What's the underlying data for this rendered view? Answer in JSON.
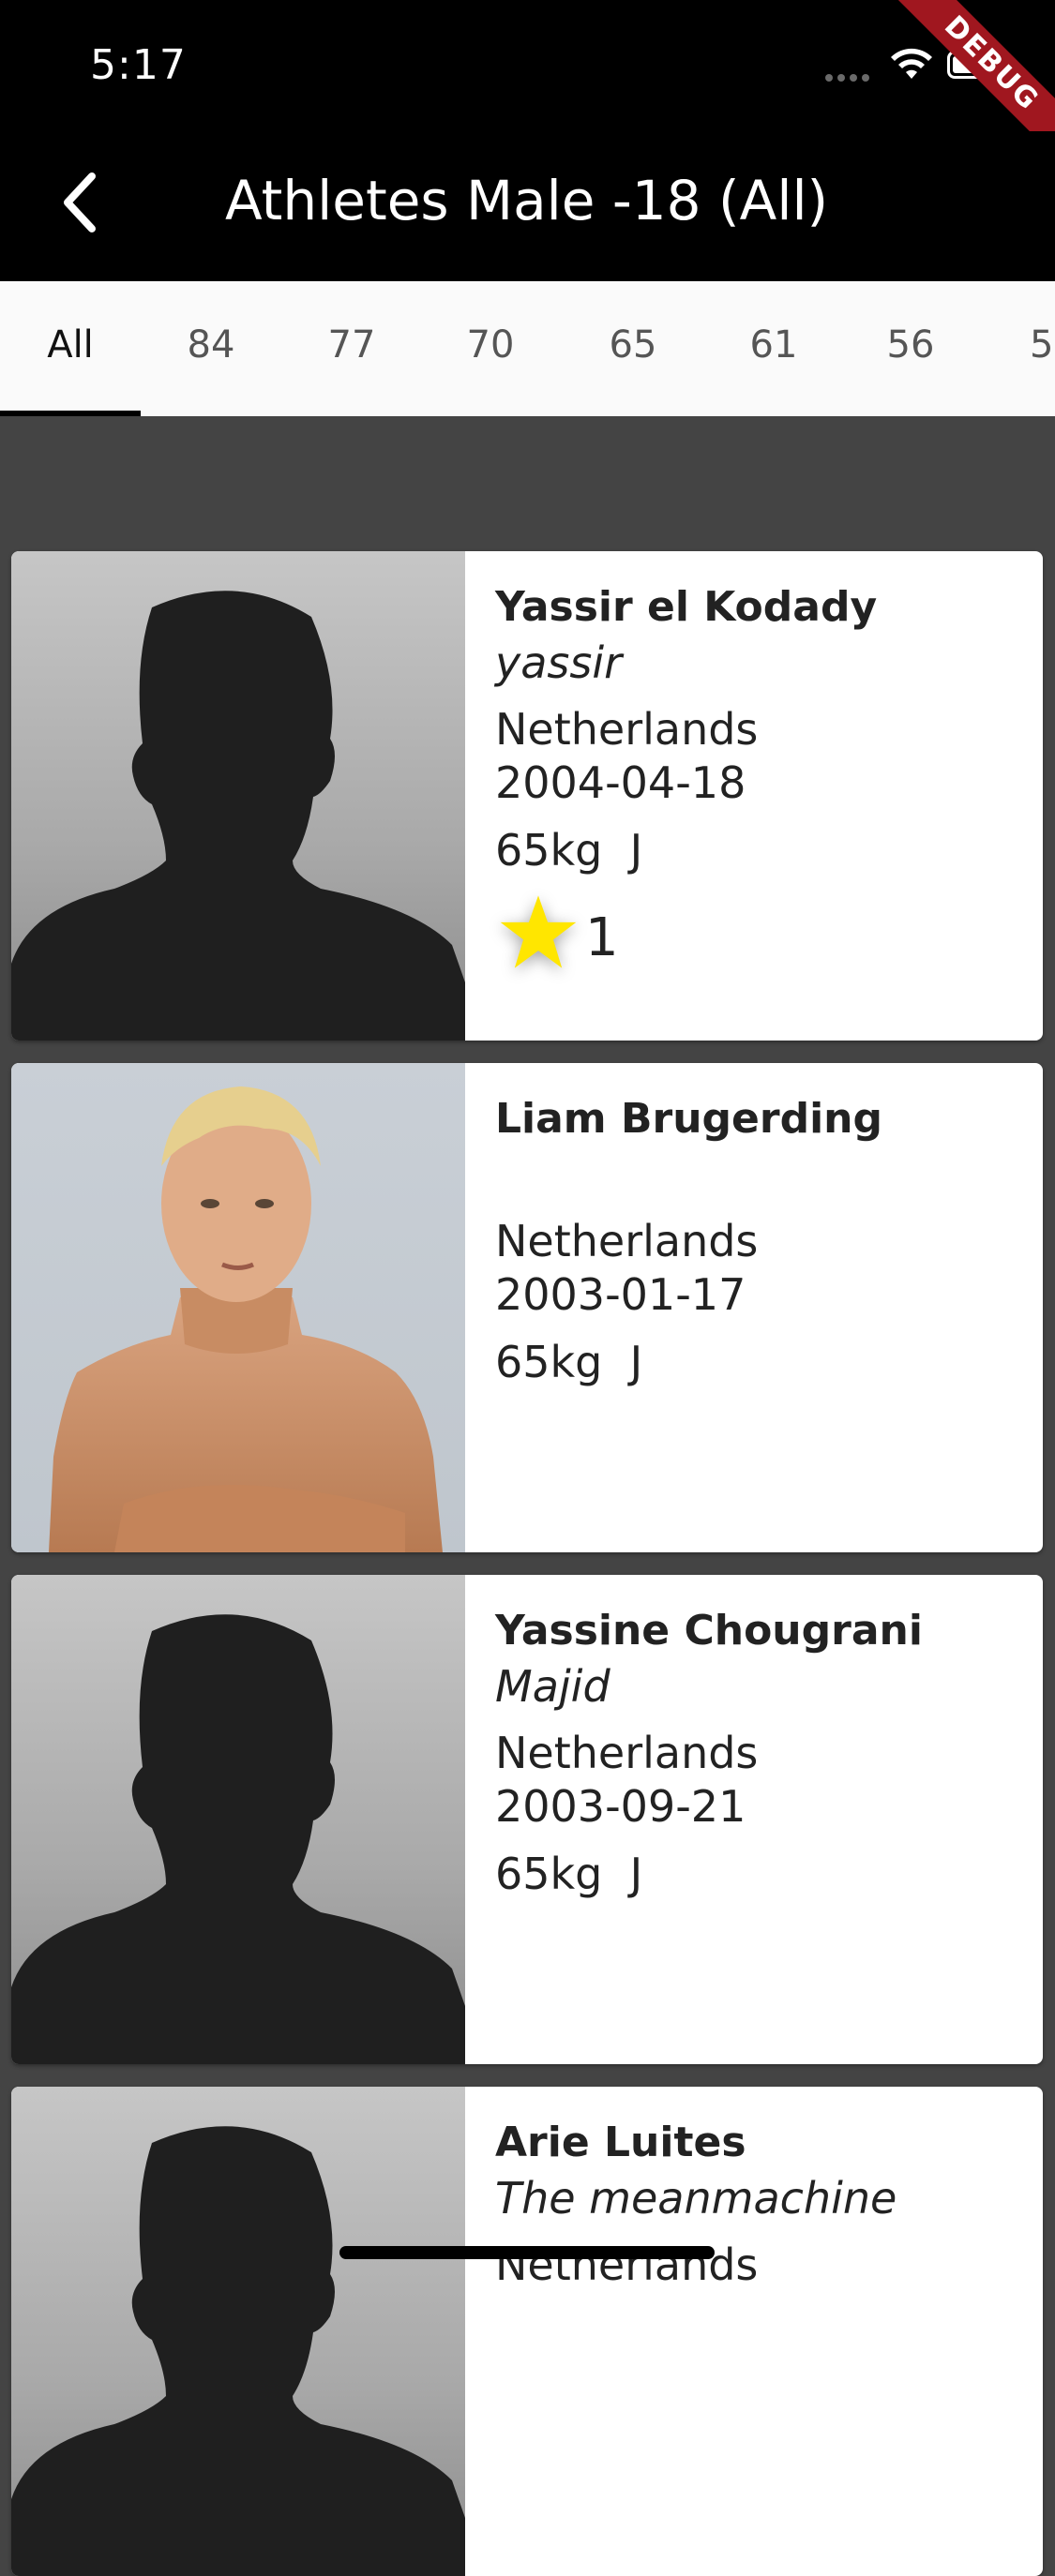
{
  "status_bar": {
    "time": "5:17"
  },
  "debug_banner": "DEBUG",
  "app_bar": {
    "title": "Athletes Male -18 (All)"
  },
  "tabs": [
    {
      "label": "All",
      "active": true
    },
    {
      "label": "84"
    },
    {
      "label": "77"
    },
    {
      "label": "70"
    },
    {
      "label": "65"
    },
    {
      "label": "61"
    },
    {
      "label": "56"
    },
    {
      "label": "5"
    }
  ],
  "athletes": [
    {
      "name": "Yassir el Kodady",
      "nickname": "yassir",
      "country": "Netherlands",
      "dob": "2004-04-18",
      "weight": "65kg",
      "category": "J",
      "stars": "1",
      "photo": "silhouette"
    },
    {
      "name": "Liam Brugerding",
      "nickname": "",
      "country": "Netherlands",
      "dob": "2003-01-17",
      "weight": "65kg",
      "category": "J",
      "photo": "photo"
    },
    {
      "name": "Yassine Chougrani",
      "nickname": "Majid",
      "country": "Netherlands",
      "dob": "2003-09-21",
      "weight": "65kg",
      "category": "J",
      "photo": "silhouette"
    },
    {
      "name": "Arie Luites",
      "nickname": "The meanmachine",
      "country": "Netherlands",
      "photo": "silhouette"
    }
  ],
  "colors": {
    "background": "#444444",
    "app_bar": "#000000",
    "tab_bar": "#fafafa",
    "star": "#ffe600",
    "debug": "#a0171f"
  },
  "icons": [
    "back-arrow-icon",
    "wifi-icon",
    "battery-icon",
    "star-icon"
  ]
}
